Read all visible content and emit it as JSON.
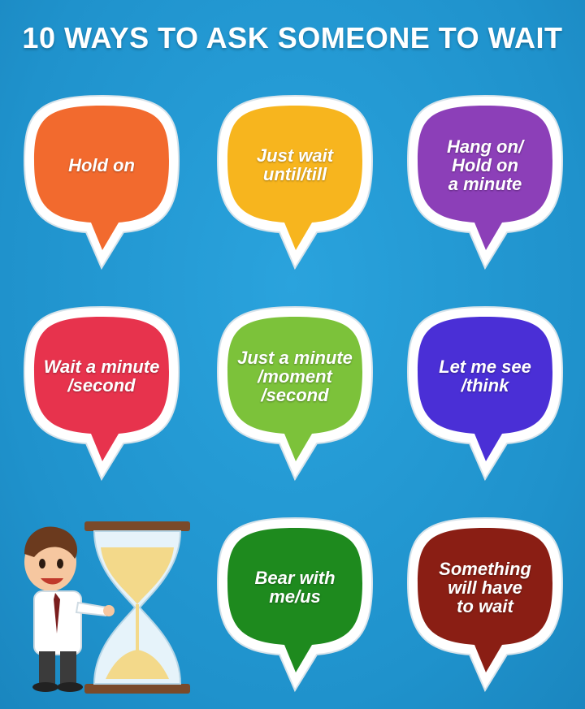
{
  "title": "10 WAYS TO ASK SOMEONE TO WAIT",
  "phrases": [
    {
      "text": "Hold on",
      "color": "#f26a2e"
    },
    {
      "text": "Just wait\nuntil/till",
      "color": "#f7b51e"
    },
    {
      "text": "Hang on/\nHold on\na minute",
      "color": "#8c3fb8"
    },
    {
      "text": "Wait a minute\n/second",
      "color": "#e7334d"
    },
    {
      "text": "Just a minute\n/moment\n/second",
      "color": "#7cc23a"
    },
    {
      "text": "Let me see\n/think",
      "color": "#4a2fd6"
    },
    {
      "text": "Bear with\nme/us",
      "color": "#1e8a1e"
    },
    {
      "text": "Something\nwill have\nto wait",
      "color": "#8a1e14"
    }
  ],
  "illustration": {
    "icon": "businessman-hourglass-icon"
  }
}
